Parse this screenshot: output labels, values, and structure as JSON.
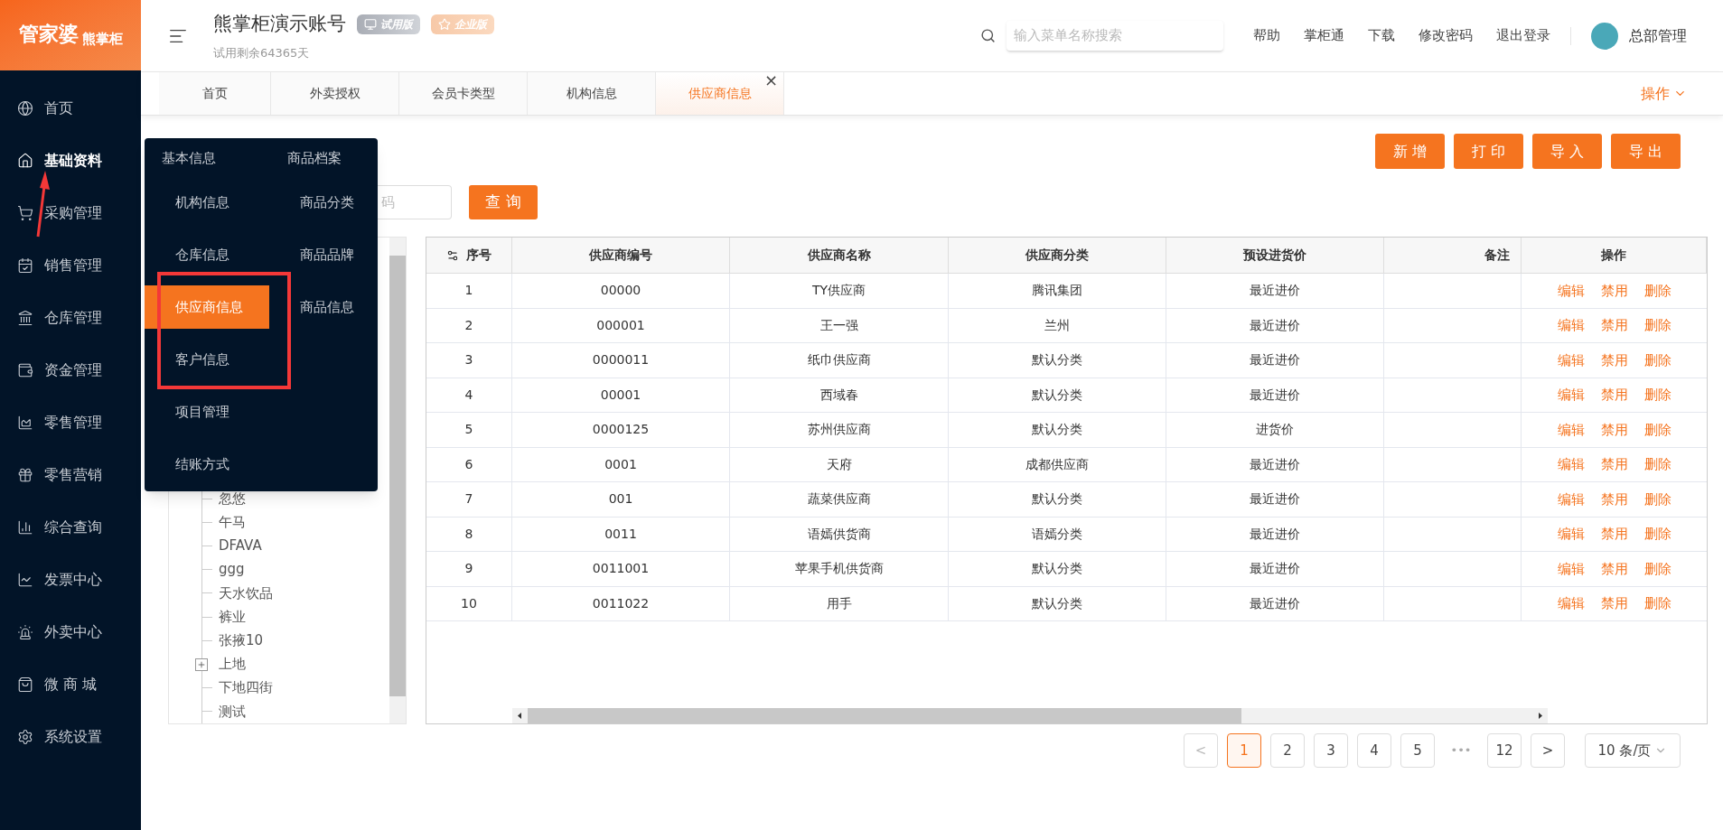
{
  "logo": {
    "text": "管家婆",
    "sub": "熊掌柜"
  },
  "sidebar": {
    "items": [
      {
        "label": "首页",
        "selected": false
      },
      {
        "label": "基础资料",
        "selected": true
      },
      {
        "label": "采购管理",
        "selected": false
      },
      {
        "label": "销售管理",
        "selected": false
      },
      {
        "label": "仓库管理",
        "selected": false
      },
      {
        "label": "资金管理",
        "selected": false
      },
      {
        "label": "零售管理",
        "selected": false
      },
      {
        "label": "零售营销",
        "selected": false
      },
      {
        "label": "综合查询",
        "selected": false
      },
      {
        "label": "发票中心",
        "selected": false
      },
      {
        "label": "外卖中心",
        "selected": false
      },
      {
        "label": "微 商 城",
        "selected": false
      },
      {
        "label": "系统设置",
        "selected": false
      }
    ]
  },
  "header": {
    "title": "熊掌柜演示账号",
    "badges": [
      {
        "label": "试用版",
        "kind": "trial"
      },
      {
        "label": "企业版",
        "kind": "enterprise"
      }
    ],
    "subtitle": "试用剩余64365天",
    "search": {
      "placeholder": "输入菜单名称搜索"
    },
    "links": [
      "帮助",
      "掌柜通",
      "下载",
      "修改密码",
      "退出登录"
    ],
    "user": "总部管理"
  },
  "tabs": {
    "items": [
      {
        "label": "首页",
        "selected": false
      },
      {
        "label": "外卖授权",
        "selected": false
      },
      {
        "label": "会员卡类型",
        "selected": false
      },
      {
        "label": "机构信息",
        "selected": false
      },
      {
        "label": "供应商信息",
        "selected": true
      }
    ],
    "close": "×",
    "menu": "操作"
  },
  "toolbar": {
    "buttons": [
      "新 增",
      "打 印",
      "导 入",
      "导 出"
    ]
  },
  "filter": {
    "placeholder": "码",
    "button": "查 询"
  },
  "popup_menu": {
    "columns": [
      {
        "title": "基本信息",
        "items": [
          {
            "label": "机构信息",
            "selected": false
          },
          {
            "label": "仓库信息",
            "selected": false
          },
          {
            "label": "供应商信息",
            "selected": true
          },
          {
            "label": "客户信息",
            "selected": false
          },
          {
            "label": "项目管理",
            "selected": false
          },
          {
            "label": "结账方式",
            "selected": false
          }
        ]
      },
      {
        "title": "商品档案",
        "items": [
          {
            "label": "商品分类",
            "selected": false
          },
          {
            "label": "商品品牌",
            "selected": false
          },
          {
            "label": "商品信息",
            "selected": false
          }
        ]
      }
    ]
  },
  "tree": {
    "items": [
      {
        "label": "忽悠",
        "kind": "leaf"
      },
      {
        "label": "午马",
        "kind": "leaf"
      },
      {
        "label": "DFAVA",
        "kind": "leaf"
      },
      {
        "label": "ggg",
        "kind": "leaf"
      },
      {
        "label": "天水饮品",
        "kind": "leaf"
      },
      {
        "label": "裤业",
        "kind": "leaf"
      },
      {
        "label": "张掖10",
        "kind": "leaf"
      },
      {
        "label": "上地",
        "kind": "folder"
      },
      {
        "label": "下地四街",
        "kind": "leaf"
      },
      {
        "label": "测试",
        "kind": "leaf"
      }
    ]
  },
  "table": {
    "columns": [
      "序号",
      "供应商编号",
      "供应商名称",
      "供应商分类",
      "预设进货价",
      "备注",
      "操作"
    ],
    "rows": [
      {
        "cells": [
          "1",
          "00000",
          "TY供应商",
          "腾讯集团",
          "最近进价",
          ""
        ],
        "actions": [
          "编辑",
          "禁用",
          "删除"
        ]
      },
      {
        "cells": [
          "2",
          "000001",
          "王一强",
          "兰州",
          "最近进价",
          ""
        ],
        "actions": [
          "编辑",
          "禁用",
          "删除"
        ]
      },
      {
        "cells": [
          "3",
          "0000011",
          "纸巾供应商",
          "默认分类",
          "最近进价",
          ""
        ],
        "actions": [
          "编辑",
          "禁用",
          "删除"
        ]
      },
      {
        "cells": [
          "4",
          "00001",
          "西域春",
          "默认分类",
          "最近进价",
          ""
        ],
        "actions": [
          "编辑",
          "禁用",
          "删除"
        ]
      },
      {
        "cells": [
          "5",
          "0000125",
          "苏州供应商",
          "默认分类",
          "进货价",
          ""
        ],
        "actions": [
          "编辑",
          "禁用",
          "删除"
        ]
      },
      {
        "cells": [
          "6",
          "0001",
          "天府",
          "成都供应商",
          "最近进价",
          ""
        ],
        "actions": [
          "编辑",
          "禁用",
          "删除"
        ]
      },
      {
        "cells": [
          "7",
          "001",
          "蔬菜供应商",
          "默认分类",
          "最近进价",
          ""
        ],
        "actions": [
          "编辑",
          "禁用",
          "删除"
        ]
      },
      {
        "cells": [
          "8",
          "0011",
          "语嫣供货商",
          "语嫣分类",
          "最近进价",
          ""
        ],
        "actions": [
          "编辑",
          "禁用",
          "删除"
        ]
      },
      {
        "cells": [
          "9",
          "0011001",
          "苹果手机供货商",
          "默认分类",
          "最近进价",
          ""
        ],
        "actions": [
          "编辑",
          "禁用",
          "删除"
        ]
      },
      {
        "cells": [
          "10",
          "0011022",
          "用手",
          "默认分类",
          "最近进价",
          ""
        ],
        "actions": [
          "编辑",
          "禁用",
          "删除"
        ]
      }
    ]
  },
  "pagination": {
    "prev": "<",
    "next": ">",
    "pages": [
      {
        "label": "1",
        "kind": "page",
        "selected": true
      },
      {
        "label": "2",
        "kind": "page",
        "selected": false
      },
      {
        "label": "3",
        "kind": "page",
        "selected": false
      },
      {
        "label": "4",
        "kind": "page",
        "selected": false
      },
      {
        "label": "5",
        "kind": "page",
        "selected": false
      },
      {
        "label": "•••",
        "kind": "ellipsis"
      },
      {
        "label": "12",
        "kind": "page",
        "selected": false
      }
    ],
    "page_size": "10 条/页"
  }
}
